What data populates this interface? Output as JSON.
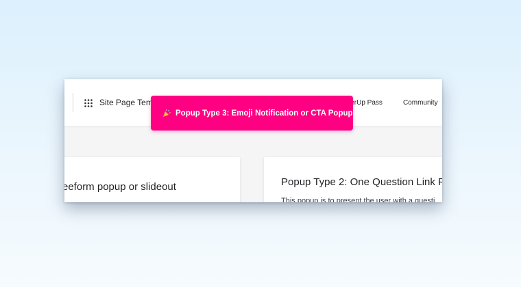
{
  "header": {
    "site_title": "Site Page Tem",
    "nav": [
      "werUp Pass",
      "Community"
    ]
  },
  "cards": [
    {
      "title": "reeform popup or slideout"
    },
    {
      "title": "Popup Type 2: One Question Link P",
      "desc": "This popup is to present the user with a questi"
    }
  ],
  "banner": {
    "emoji": "🎉",
    "text": "Popup Type 3: Emoji Notification or CTA Popup"
  },
  "colors": {
    "banner_bg": "#ff0083",
    "page_bg": "#f5f5f6",
    "backdrop_top": "#dcf0fd"
  }
}
